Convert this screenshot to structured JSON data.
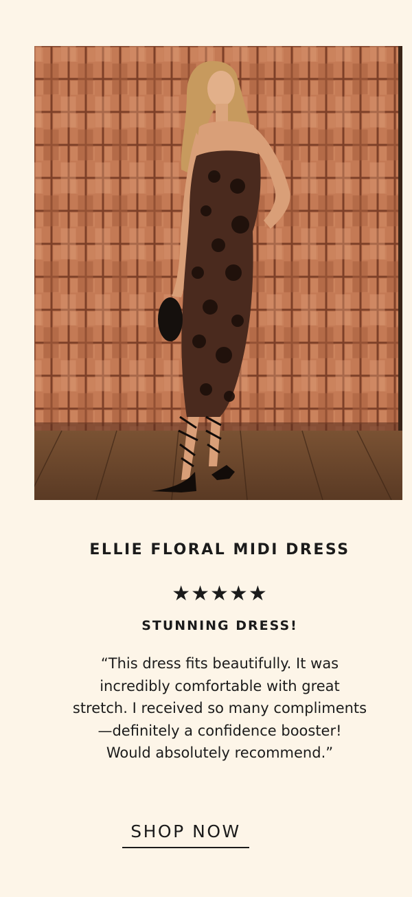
{
  "product": {
    "name": "ELLIE FLORAL MIDI DRESS"
  },
  "review": {
    "rating": 5,
    "stars": "★★★★★",
    "title": "STUNNING DRESS!",
    "lines": [
      "“This dress fits beautifully. It was",
      "incredibly comfortable with great",
      "stretch. I received so many compliments",
      "—definitely a confidence booster!",
      "Would absolutely recommend.”"
    ]
  },
  "cta": {
    "label": "SHOP NOW"
  },
  "colors": {
    "background": "#fdf5e8",
    "text": "#1b1b1b"
  }
}
